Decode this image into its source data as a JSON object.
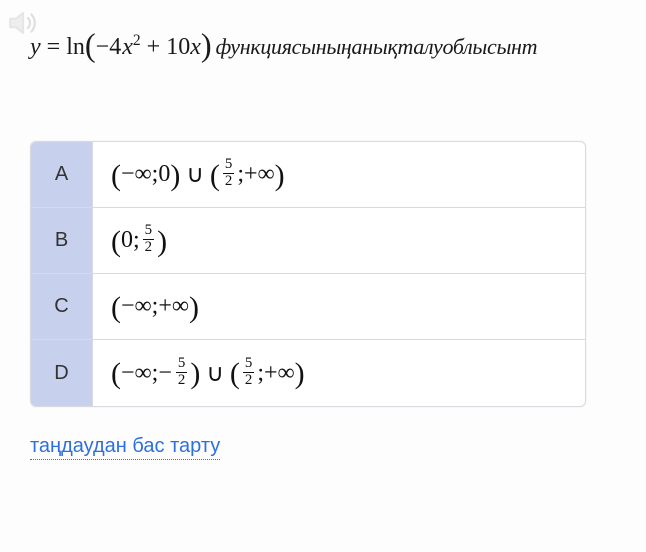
{
  "question": {
    "lhs_var": "y",
    "eq": " = ",
    "func": "ln",
    "inner_prefix": "−4",
    "inner_var": "x",
    "inner_exp": "2",
    "inner_plus": " + 10",
    "inner_var2": "x",
    "tail": "функциясыныңанықталуоблысынт"
  },
  "options": [
    {
      "letter": "A",
      "parts": {
        "open1": "(",
        "a1": "−∞",
        "sep1": "; ",
        "b1": "0",
        "close1": ")",
        "cup": " ∪ ",
        "open2": "(",
        "frac2_num": "5",
        "frac2_den": "2",
        "sep2": "; ",
        "b2": "+∞",
        "close2": ")"
      }
    },
    {
      "letter": "B",
      "parts": {
        "open1": "(",
        "a1": "0",
        "sep1": "; ",
        "frac1_num": "5",
        "frac1_den": "2",
        "close1": ")"
      }
    },
    {
      "letter": "C",
      "parts": {
        "open1": "(",
        "a1": "−∞",
        "sep1": "; ",
        "b1": "+∞",
        "close1": ")"
      }
    },
    {
      "letter": "D",
      "parts": {
        "open1": "(",
        "a1": "−∞",
        "sep1": "; ",
        "neg1": "−",
        "frac1_num": "5",
        "frac1_den": "2",
        "close1": ")",
        "cup": " ∪ ",
        "open2": "(",
        "frac2_num": "5",
        "frac2_den": "2",
        "sep2": "; ",
        "b2": "+∞",
        "close2": ")"
      }
    }
  ],
  "declineLabel": "таңдаудан бас тарту",
  "icons": {
    "audio": "speaker-icon"
  }
}
